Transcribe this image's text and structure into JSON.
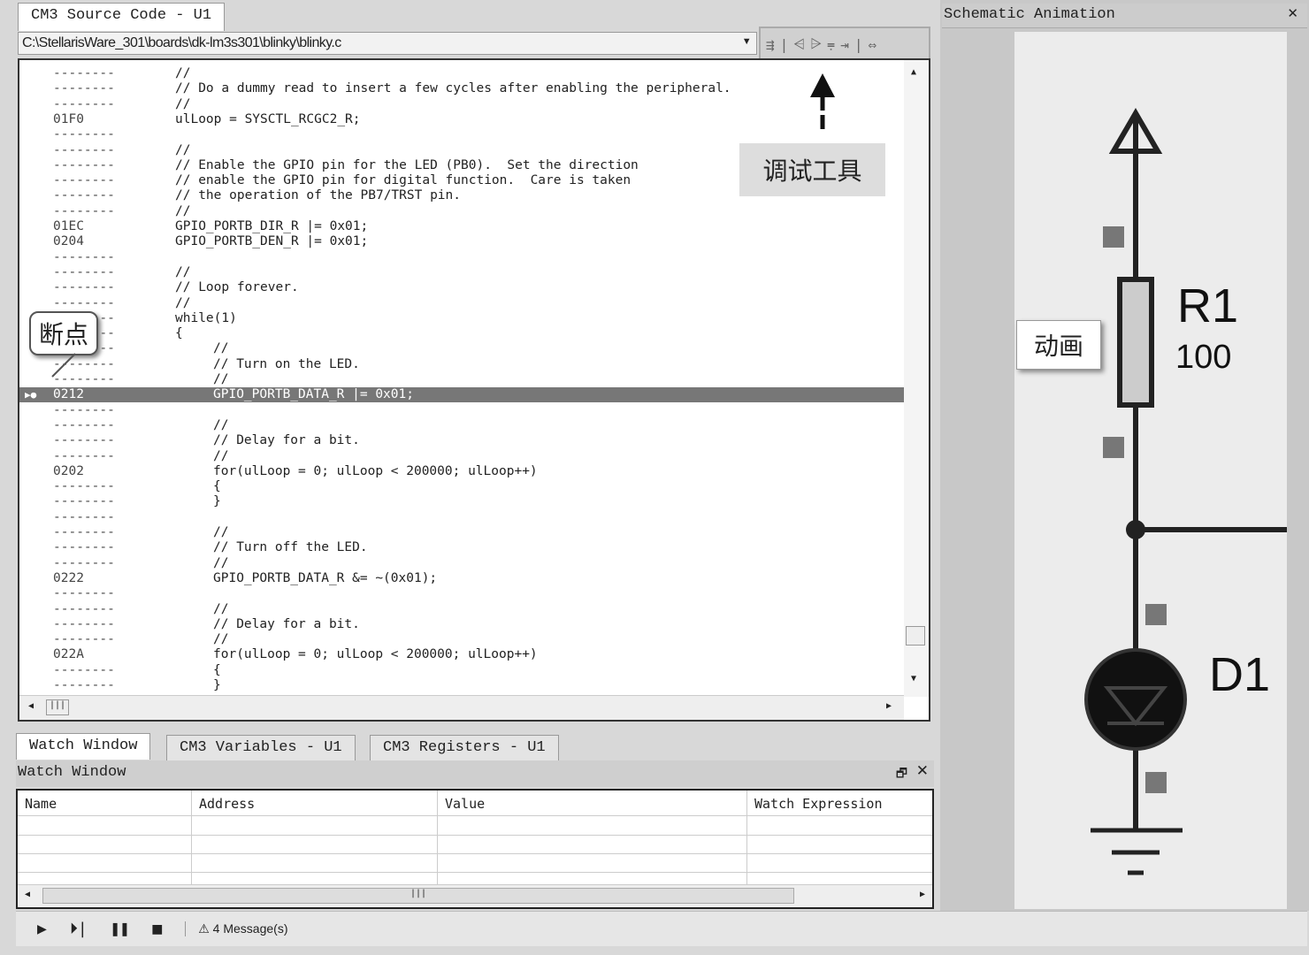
{
  "source_tab": "CM3 Source Code - U1",
  "file_path": "C:\\StellarisWare_301\\boards\\dk-lm3s301\\blinky\\blinky.c",
  "toolbar_icons": [
    "run-to-cursor-icon",
    "step-over-icon",
    "step-into-icon",
    "step-out-icon",
    "return-icon",
    "toggle-view-icon"
  ],
  "code_rows": [
    {
      "a": "--------",
      "i": 0,
      "t": "//"
    },
    {
      "a": "--------",
      "i": 0,
      "t": "// Do a dummy read to insert a few cycles after enabling the peripheral."
    },
    {
      "a": "--------",
      "i": 0,
      "t": "//"
    },
    {
      "a": "01F0",
      "i": 0,
      "t": "ulLoop = SYSCTL_RCGC2_R;"
    },
    {
      "a": "--------",
      "i": 0,
      "t": ""
    },
    {
      "a": "--------",
      "i": 0,
      "t": "//"
    },
    {
      "a": "--------",
      "i": 0,
      "t": "// Enable the GPIO pin for the LED (PB0).  Set the direction"
    },
    {
      "a": "--------",
      "i": 0,
      "t": "// enable the GPIO pin for digital function.  Care is taken"
    },
    {
      "a": "--------",
      "i": 0,
      "t": "// the operation of the PB7/TRST pin."
    },
    {
      "a": "--------",
      "i": 0,
      "t": "//"
    },
    {
      "a": "01EC",
      "i": 0,
      "t": "GPIO_PORTB_DIR_R |= 0x01;"
    },
    {
      "a": "0204",
      "i": 0,
      "t": "GPIO_PORTB_DEN_R |= 0x01;"
    },
    {
      "a": "--------",
      "i": 0,
      "t": ""
    },
    {
      "a": "--------",
      "i": 0,
      "t": "//"
    },
    {
      "a": "--------",
      "i": 0,
      "t": "// Loop forever."
    },
    {
      "a": "--------",
      "i": 0,
      "t": "//"
    },
    {
      "a": "--------",
      "i": 0,
      "t": "while(1)"
    },
    {
      "a": "--------",
      "i": 0,
      "t": "{"
    },
    {
      "a": "--------",
      "i": 1,
      "t": "//"
    },
    {
      "a": "--------",
      "i": 1,
      "t": "// Turn on the LED."
    },
    {
      "a": "--------",
      "i": 1,
      "t": "//"
    },
    {
      "a": "0212",
      "i": 1,
      "t": "GPIO_PORTB_DATA_R |= 0x01;",
      "hl": true
    },
    {
      "a": "--------",
      "i": 1,
      "t": ""
    },
    {
      "a": "--------",
      "i": 1,
      "t": "//"
    },
    {
      "a": "--------",
      "i": 1,
      "t": "// Delay for a bit."
    },
    {
      "a": "--------",
      "i": 1,
      "t": "//"
    },
    {
      "a": "0202",
      "i": 1,
      "t": "for(ulLoop = 0; ulLoop < 200000; ulLoop++)"
    },
    {
      "a": "--------",
      "i": 1,
      "t": "{"
    },
    {
      "a": "--------",
      "i": 1,
      "t": "}"
    },
    {
      "a": "--------",
      "i": 1,
      "t": ""
    },
    {
      "a": "--------",
      "i": 1,
      "t": "//"
    },
    {
      "a": "--------",
      "i": 1,
      "t": "// Turn off the LED."
    },
    {
      "a": "--------",
      "i": 1,
      "t": "//"
    },
    {
      "a": "0222",
      "i": 1,
      "t": "GPIO_PORTB_DATA_R &= ~(0x01);"
    },
    {
      "a": "--------",
      "i": 1,
      "t": ""
    },
    {
      "a": "--------",
      "i": 1,
      "t": "//"
    },
    {
      "a": "--------",
      "i": 1,
      "t": "// Delay for a bit."
    },
    {
      "a": "--------",
      "i": 1,
      "t": "//"
    },
    {
      "a": "022A",
      "i": 1,
      "t": "for(ulLoop = 0; ulLoop < 200000; ulLoop++)"
    },
    {
      "a": "--------",
      "i": 1,
      "t": "{"
    },
    {
      "a": "--------",
      "i": 1,
      "t": "}"
    }
  ],
  "bottom_tabs": [
    "Watch Window",
    "CM3 Variables - U1",
    "CM3 Registers - U1"
  ],
  "watch": {
    "title": "Watch Window",
    "columns": [
      "Name",
      "Address",
      "Value",
      "Watch Expression"
    ]
  },
  "status": {
    "messages": "4 Message(s)"
  },
  "schematic": {
    "title": "Schematic Animation",
    "r_label": "R1",
    "r_value": "100",
    "d_label": "D1"
  },
  "callouts": {
    "debug_tools": "调试工具",
    "breakpoint": "断点",
    "animation": "动画"
  }
}
